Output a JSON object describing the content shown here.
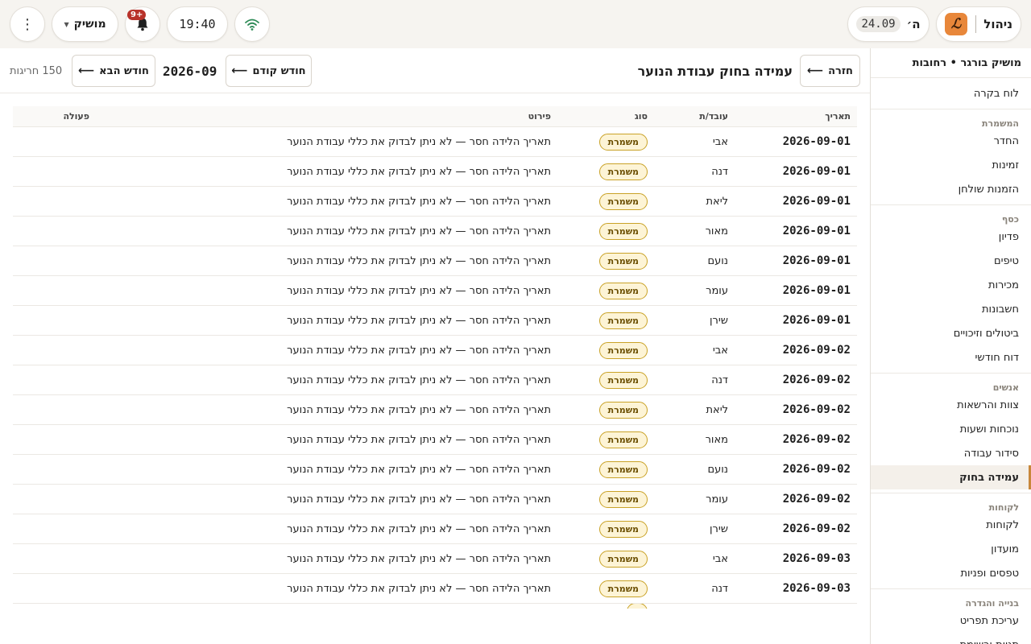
{
  "topbar": {
    "brand_label": "ניהול",
    "brand_logo": "ℒ",
    "day_label": "ה׳",
    "date": "24.09",
    "clock": "19:40",
    "notifications_badge": "9+",
    "user_label": "מושיק",
    "more_glyph": "⋮"
  },
  "sidebar": {
    "title": "מושיק בורגר • רחובות",
    "dashboard": "לוח בקרה",
    "groups": [
      {
        "label": "המשמרת",
        "items": [
          "החדר",
          "זמינות",
          "הזמנות שולחן"
        ]
      },
      {
        "label": "כסף",
        "items": [
          "פדיון",
          "טיפים",
          "מכירות",
          "חשבונות",
          "ביטולים וזיכויים",
          "דוח חודשי"
        ]
      },
      {
        "label": "אנשים",
        "items": [
          "צוות והרשאות",
          "נוכחות ושעות",
          "סידור עבודה",
          "עמידה בחוק"
        ]
      },
      {
        "label": "לקוחות",
        "items": [
          "לקוחות",
          "מועדון",
          "טפסים ופניות"
        ]
      },
      {
        "label": "בנייה והגדרה",
        "items": [
          "עריכת תפריט",
          "תגיות ורשימת"
        ]
      }
    ],
    "active_item": "עמידה בחוק"
  },
  "header": {
    "back_label": "חזרה",
    "title": "עמידה בחוק עבודת הנוער",
    "prev_label": "חודש קודם",
    "month": "2026-09",
    "next_label": "חודש הבא",
    "violations_count": "150 חריגות"
  },
  "table": {
    "columns": {
      "date": "תאריך",
      "employee": "עובד/ת",
      "type": "סוג",
      "detail": "פירוט",
      "action": "פעולה"
    },
    "rows": [
      {
        "date": "2026-09-01",
        "employee": "אבי",
        "type": "משמרת",
        "detail": "תאריך הלידה חסר — לא ניתן לבדוק את כללי עבודת הנוער"
      },
      {
        "date": "2026-09-01",
        "employee": "דנה",
        "type": "משמרת",
        "detail": "תאריך הלידה חסר — לא ניתן לבדוק את כללי עבודת הנוער"
      },
      {
        "date": "2026-09-01",
        "employee": "ליאת",
        "type": "משמרת",
        "detail": "תאריך הלידה חסר — לא ניתן לבדוק את כללי עבודת הנוער"
      },
      {
        "date": "2026-09-01",
        "employee": "מאור",
        "type": "משמרת",
        "detail": "תאריך הלידה חסר — לא ניתן לבדוק את כללי עבודת הנוער"
      },
      {
        "date": "2026-09-01",
        "employee": "נועם",
        "type": "משמרת",
        "detail": "תאריך הלידה חסר — לא ניתן לבדוק את כללי עבודת הנוער"
      },
      {
        "date": "2026-09-01",
        "employee": "עומר",
        "type": "משמרת",
        "detail": "תאריך הלידה חסר — לא ניתן לבדוק את כללי עבודת הנוער"
      },
      {
        "date": "2026-09-01",
        "employee": "שירן",
        "type": "משמרת",
        "detail": "תאריך הלידה חסר — לא ניתן לבדוק את כללי עבודת הנוער"
      },
      {
        "date": "2026-09-02",
        "employee": "אבי",
        "type": "משמרת",
        "detail": "תאריך הלידה חסר — לא ניתן לבדוק את כללי עבודת הנוער"
      },
      {
        "date": "2026-09-02",
        "employee": "דנה",
        "type": "משמרת",
        "detail": "תאריך הלידה חסר — לא ניתן לבדוק את כללי עבודת הנוער"
      },
      {
        "date": "2026-09-02",
        "employee": "ליאת",
        "type": "משמרת",
        "detail": "תאריך הלידה חסר — לא ניתן לבדוק את כללי עבודת הנוער"
      },
      {
        "date": "2026-09-02",
        "employee": "מאור",
        "type": "משמרת",
        "detail": "תאריך הלידה חסר — לא ניתן לבדוק את כללי עבודת הנוער"
      },
      {
        "date": "2026-09-02",
        "employee": "נועם",
        "type": "משמרת",
        "detail": "תאריך הלידה חסר — לא ניתן לבדוק את כללי עבודת הנוער"
      },
      {
        "date": "2026-09-02",
        "employee": "עומר",
        "type": "משמרת",
        "detail": "תאריך הלידה חסר — לא ניתן לבדוק את כללי עבודת הנוער"
      },
      {
        "date": "2026-09-02",
        "employee": "שירן",
        "type": "משמרת",
        "detail": "תאריך הלידה חסר — לא ניתן לבדוק את כללי עבודת הנוער"
      },
      {
        "date": "2026-09-03",
        "employee": "אבי",
        "type": "משמרת",
        "detail": "תאריך הלידה חסר — לא ניתן לבדוק את כללי עבודת הנוער"
      },
      {
        "date": "2026-09-03",
        "employee": "דנה",
        "type": "משמרת",
        "detail": "תאריך הלידה חסר — לא ניתן לבדוק את כללי עבודת הנוער"
      }
    ]
  },
  "colors": {
    "accent": "#c8873a",
    "brand_logo_bg": "#e8873a",
    "badge_bg": "#fdf4d6",
    "badge_border": "#c9a227",
    "notification": "#b8322a"
  }
}
